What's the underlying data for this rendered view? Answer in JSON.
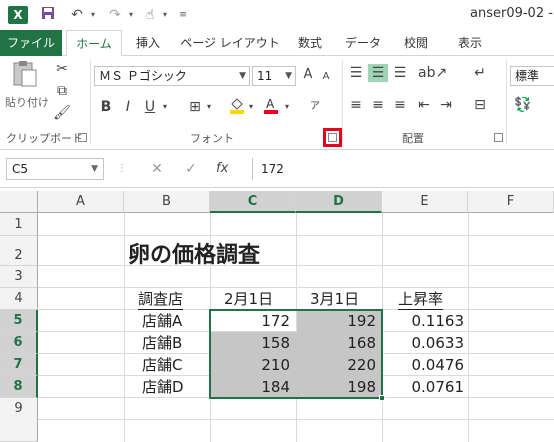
{
  "app": {
    "logo": "X",
    "window_title": "anser09-02 -"
  },
  "qat": {
    "save_icon": "save-icon",
    "undo_icon": "undo-icon",
    "redo_icon": "redo-icon",
    "touch_icon": "touch-mode-icon",
    "more_icon": "customize-qat-icon"
  },
  "tabs": {
    "file": "ファイル",
    "home": "ホーム",
    "insert": "挿入",
    "page_layout": "ページ レイアウト",
    "formulas": "数式",
    "data": "データ",
    "review": "校閲",
    "view": "表示"
  },
  "ribbon": {
    "clipboard": {
      "paste_label": "貼り付け",
      "group_label": "クリップボード"
    },
    "font": {
      "font_name": "ＭＳ Ｐゴシック",
      "font_size": "11",
      "bold": "B",
      "italic": "I",
      "underline": "U",
      "grow": "A",
      "shrink": "A",
      "group_label": "フォント",
      "font_color": "#e8001c",
      "fill_color": "#ffd700"
    },
    "alignment": {
      "group_label": "配置"
    },
    "number": {
      "format": "標準"
    }
  },
  "formula_bar": {
    "name_box": "C5",
    "cancel": "✕",
    "enter": "✓",
    "fx": "fx",
    "formula": "172"
  },
  "sheet": {
    "columns": [
      "A",
      "B",
      "C",
      "D",
      "E",
      "F"
    ],
    "rows": [
      "1",
      "2",
      "3",
      "4",
      "5",
      "6",
      "7",
      "8",
      "9"
    ],
    "title": "卵の価格調査",
    "headers": [
      "調査店",
      "2月1日",
      "3月1日",
      "上昇率"
    ],
    "table": [
      [
        "店舗A",
        "172",
        "192",
        "0.1163"
      ],
      [
        "店舗B",
        "158",
        "168",
        "0.0633"
      ],
      [
        "店舗C",
        "210",
        "220",
        "0.0476"
      ],
      [
        "店舗D",
        "184",
        "198",
        "0.0761"
      ]
    ],
    "accent_color": "#217346"
  }
}
